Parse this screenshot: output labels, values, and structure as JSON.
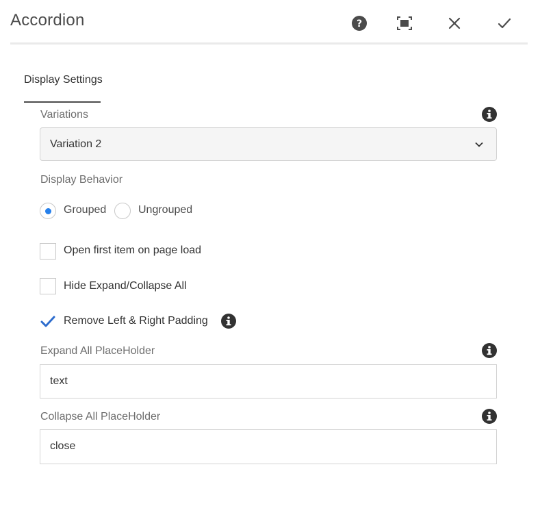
{
  "dialog": {
    "title": "Accordion",
    "actions": [
      "help-icon",
      "fullscreen-icon",
      "close-icon",
      "done-icon"
    ]
  },
  "tabs": [
    {
      "label": "Display Settings",
      "active": true
    }
  ],
  "variations": {
    "label": "Variations",
    "selected": "Variation 2"
  },
  "display_behavior": {
    "label": "Display Behavior",
    "options": [
      {
        "label": "Grouped",
        "selected": true
      },
      {
        "label": "Ungrouped",
        "selected": false
      }
    ]
  },
  "checkboxes": [
    {
      "label": "Open first item on page load",
      "checked": false
    },
    {
      "label": "Hide Expand/Collapse All",
      "checked": false
    },
    {
      "label": "Remove Left & Right Padding",
      "checked": true
    }
  ],
  "expand_placeholder": {
    "label": "Expand All PlaceHolder",
    "value": "text"
  },
  "collapse_placeholder": {
    "label": "Collapse All PlaceHolder",
    "value": "close"
  },
  "colors": {
    "accent": "#2680eb",
    "icon": "#4b4b4b",
    "check": "#2d6ccd"
  }
}
